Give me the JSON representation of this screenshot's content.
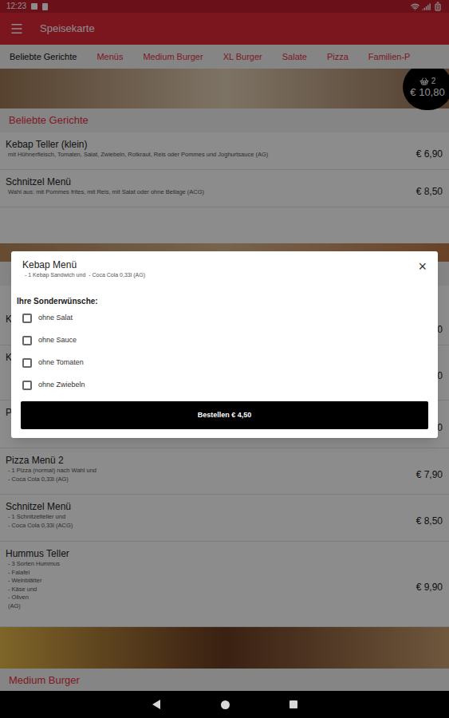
{
  "status_bar": {
    "time": "12:23"
  },
  "app_bar": {
    "title": "Speisekarte"
  },
  "tabs": [
    {
      "label": "Beliebte Gerichte",
      "selected": true
    },
    {
      "label": "Menüs",
      "selected": false
    },
    {
      "label": "Medium Burger",
      "selected": false
    },
    {
      "label": "XL Burger",
      "selected": false
    },
    {
      "label": "Salate",
      "selected": false
    },
    {
      "label": "Pizza",
      "selected": false
    },
    {
      "label": "Familien-P",
      "selected": false
    }
  ],
  "cart": {
    "count": "2",
    "total": "€ 10,80"
  },
  "popular": {
    "header": "Beliebte Gerichte",
    "items": [
      {
        "name": "Kebap Teller (klein)",
        "description": "mit Hühnerfleisch, Tomaten, Salat, Zwiebeln, Rotkraut, Reis oder Pommes und Joghurtsauce (AG)",
        "price": "€ 6,90"
      },
      {
        "name": "Schnitzel Menü",
        "description": "Wahl aus: mit Pommes frites, mit Reis, mit Salat oder ohne Beilage (ACG)",
        "price": "€ 8,50"
      }
    ]
  },
  "menus": {
    "items": [
      {
        "name": "K",
        "description": [],
        "price": "0"
      },
      {
        "name": "K",
        "description": [],
        "price": "0"
      },
      {
        "name": "P",
        "description": [],
        "price": "0"
      },
      {
        "name": "Pizza Menü 2",
        "description": [
          "- 1 Pizza (normal) nach Wahl und",
          "- Coca Cola 0,33l (AG)"
        ],
        "price": "€ 7,90"
      },
      {
        "name": "Schnitzel Menü",
        "description": [
          "- 1 Schnitzelteller und",
          "- Coca Cola 0,33l (ACG)"
        ],
        "price": "€ 8,50"
      },
      {
        "name": "Hummus Teller",
        "description": [
          "- 3 Sorten Hummus",
          "- Falafel",
          "- Weinblätter",
          "- Käse und",
          "- Oliven",
          "(AG)"
        ],
        "price": "€ 9,90"
      }
    ]
  },
  "next_section": {
    "header": "Medium Burger"
  },
  "dialog": {
    "title": "Kebap Menü",
    "subtitle": "- 1 Kebap Sandwich und  - Coca Cola 0,33l (AG)",
    "close": "×",
    "options_heading": "Ihre Sonderwünsche:",
    "options": [
      {
        "label": "ohne Salat",
        "checked": false
      },
      {
        "label": "ohne Sauce",
        "checked": false
      },
      {
        "label": "ohne Tomaten",
        "checked": false
      },
      {
        "label": "ohne Zwiebeln",
        "checked": false
      }
    ],
    "order_button": "Bestellen € 4,50"
  }
}
